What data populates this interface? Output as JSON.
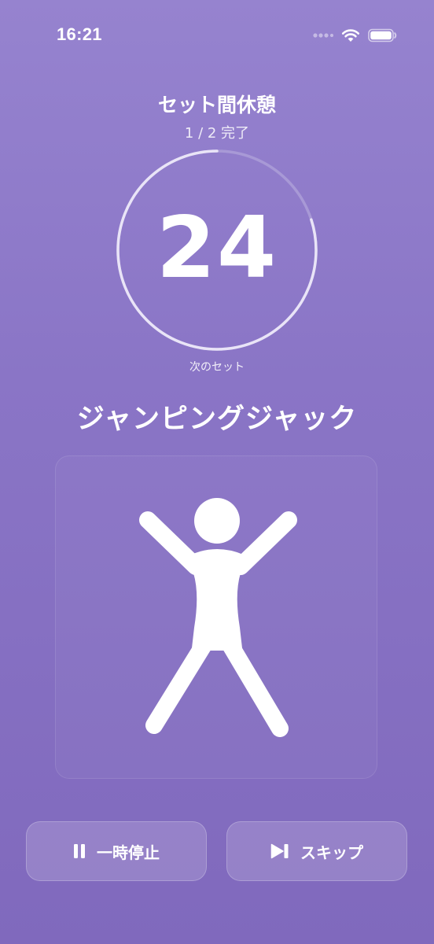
{
  "status_bar": {
    "time": "16:21",
    "icons": [
      "signal-icon",
      "wifi-icon",
      "battery-icon"
    ]
  },
  "rest": {
    "title": "セット間休憩",
    "progress_text": "1 / 2 完了",
    "countdown": "24",
    "countdown_fraction_remaining": 0.8,
    "next_label": "次のセット"
  },
  "exercise": {
    "name": "ジャンピングジャック",
    "illustration_icon": "jumping-jack-figure-icon"
  },
  "controls": {
    "pause_label": "一時停止",
    "pause_icon": "pause-icon",
    "skip_label": "スキップ",
    "skip_icon": "skip-forward-icon"
  },
  "colors": {
    "background_top": "#9683cf",
    "background_bottom": "#8069bd",
    "ring_track": "#a899d6",
    "ring_progress": "#e9e4f7",
    "foreground": "#ffffff"
  }
}
